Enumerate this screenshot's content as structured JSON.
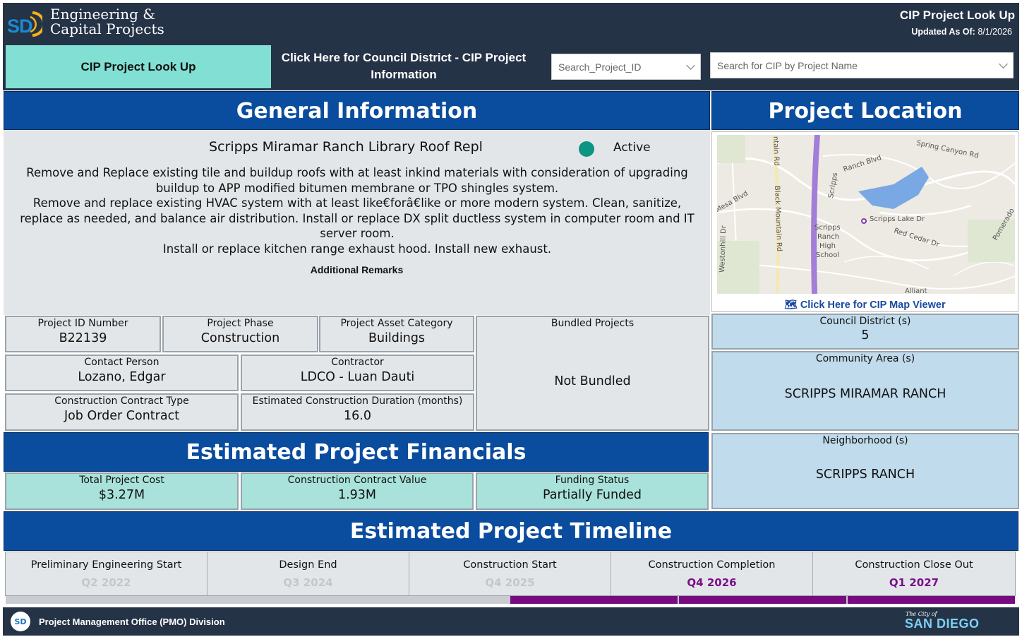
{
  "header": {
    "brand_line1": "Engineering &",
    "brand_line2": "Capital Projects",
    "logo_text": "SD",
    "title": "CIP Project Look Up",
    "updated_label": "Updated As Of:",
    "updated_value": "8/1/2026",
    "tab_active": "CIP Project Look Up",
    "tab_link": "Click Here for Council District - CIP Project Information",
    "search_id_placeholder": "Search_Project_ID",
    "search_name_placeholder": "Search for CIP by Project Name"
  },
  "general": {
    "heading": "General Information",
    "project_name": "Scripps Miramar Ranch Library Roof Repl",
    "status": "Active",
    "status_color": "#0d9483",
    "description_lines": [
      "Remove and Replace existing tile and buildup roofs with at least inkind materials with consideration of upgrading buildup to APP modified bitumen membrane or TPO shingles system.",
      "Remove and replace existing HVAC system with at least like€forâ€like or more modern system. Clean, sanitize, replace as needed, and balance air distribution. Install or replace DX split ductless system in computer room and IT server room.",
      "Install or replace kitchen range exhaust hood. Install new exhaust."
    ],
    "remarks_label": "Additional Remarks"
  },
  "fields": {
    "project_id": {
      "label": "Project ID Number",
      "value": "B22139"
    },
    "phase": {
      "label": "Project Phase",
      "value": "Construction"
    },
    "asset": {
      "label": "Project Asset Category",
      "value": "Buildings"
    },
    "bundled": {
      "label": "Bundled Projects",
      "value": "Not Bundled"
    },
    "contact": {
      "label": "Contact Person",
      "value": "Lozano, Edgar"
    },
    "contractor": {
      "label": "Contractor",
      "value": "LDCO - Luan Dauti"
    },
    "contract_type": {
      "label": "Construction Contract Type",
      "value": "Job Order Contract"
    },
    "duration": {
      "label": "Estimated Construction Duration (months)",
      "value": "16.0"
    }
  },
  "financials": {
    "heading": "Estimated Project Financials",
    "total_cost": {
      "label": "Total Project Cost",
      "value": "$3.27M"
    },
    "contract_value": {
      "label": "Construction Contract Value",
      "value": "1.93M"
    },
    "funding": {
      "label": "Funding Status",
      "value": "Partially Funded"
    }
  },
  "location": {
    "heading": "Project Location",
    "map_link": "Click Here for CIP Map Viewer",
    "map_labels": [
      "Spring Canyon Rd",
      "Ranch Blvd",
      "Scripps",
      "Scripps Lake Dr",
      "Red Cedar Dr",
      "Pomerado",
      "Mesa Blvd",
      "Black Mountain Rd",
      "Westonhill Dr",
      "Scripps Ranch High School",
      "Alliant",
      "ntain Rd"
    ],
    "council": {
      "label": "Council District (s)",
      "value": "5"
    },
    "community": {
      "label": "Community Area (s)",
      "value": "SCRIPPS MIRAMAR RANCH"
    },
    "neighborhood": {
      "label": "Neighborhood (s)",
      "value": "SCRIPPS RANCH"
    }
  },
  "timeline": {
    "heading": "Estimated Project Timeline",
    "milestones": [
      {
        "label": "Preliminary Engineering Start",
        "value": "Q2 2022",
        "state": "past"
      },
      {
        "label": "Design End",
        "value": "Q3 2024",
        "state": "past"
      },
      {
        "label": "Construction Start",
        "value": "Q4 2025",
        "state": "past"
      },
      {
        "label": "Construction Completion",
        "value": "Q4 2026",
        "state": "future"
      },
      {
        "label": "Construction Close Out",
        "value": "Q1 2027",
        "state": "future"
      }
    ],
    "progress_bar_color": "#780b80"
  },
  "footer": {
    "logo_text": "SD",
    "division": "Project Management Office (PMO) Division",
    "city_small": "The City of",
    "city": "SAN DIEGO"
  }
}
